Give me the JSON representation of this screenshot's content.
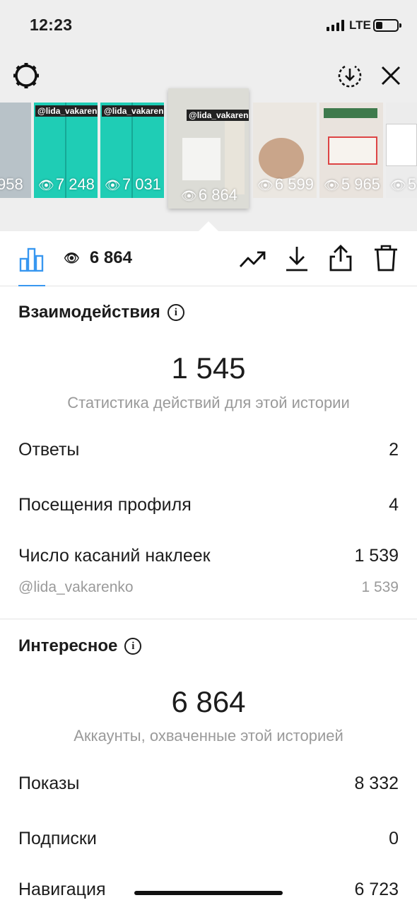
{
  "status_bar": {
    "time": "12:23",
    "network": "LTE",
    "battery_percent": 25
  },
  "thumbnails": [
    {
      "handle": "",
      "views": "958",
      "bg": "#b8c2c8"
    },
    {
      "handle": "@lida_vakarenko",
      "views": "7 248",
      "bg": "#1fcdb5"
    },
    {
      "handle": "@lida_vakarenko",
      "views": "7 031",
      "bg": "#1fcdb5"
    },
    {
      "handle": "@lida_vakarenko",
      "views": "6 864",
      "bg": "#dcdcd6",
      "active": true
    },
    {
      "handle": "",
      "views": "6 599",
      "bg": "#ebe7e1"
    },
    {
      "handle": "",
      "views": "5 965",
      "bg": "#e9e3dd"
    },
    {
      "handle": "",
      "views": "5",
      "bg": "#ececec"
    }
  ],
  "toolbar": {
    "views": "6 864"
  },
  "interactions": {
    "title": "Взаимодействия",
    "total": "1 545",
    "caption": "Статистика действий для этой истории",
    "rows": [
      {
        "label": "Ответы",
        "value": "2"
      },
      {
        "label": "Посещения профиля",
        "value": "4"
      },
      {
        "label": "Число касаний наклеек",
        "value": "1 539"
      }
    ],
    "sub_row": {
      "label": "@lida_vakarenko",
      "value": "1 539"
    }
  },
  "discovery": {
    "title": "Интересное",
    "total": "6 864",
    "caption": "Аккаунты, охваченные этой историей",
    "rows": [
      {
        "label": "Показы",
        "value": "8 332"
      },
      {
        "label": "Подписки",
        "value": "0"
      },
      {
        "label": "Навигация",
        "value": "6 723"
      }
    ]
  }
}
